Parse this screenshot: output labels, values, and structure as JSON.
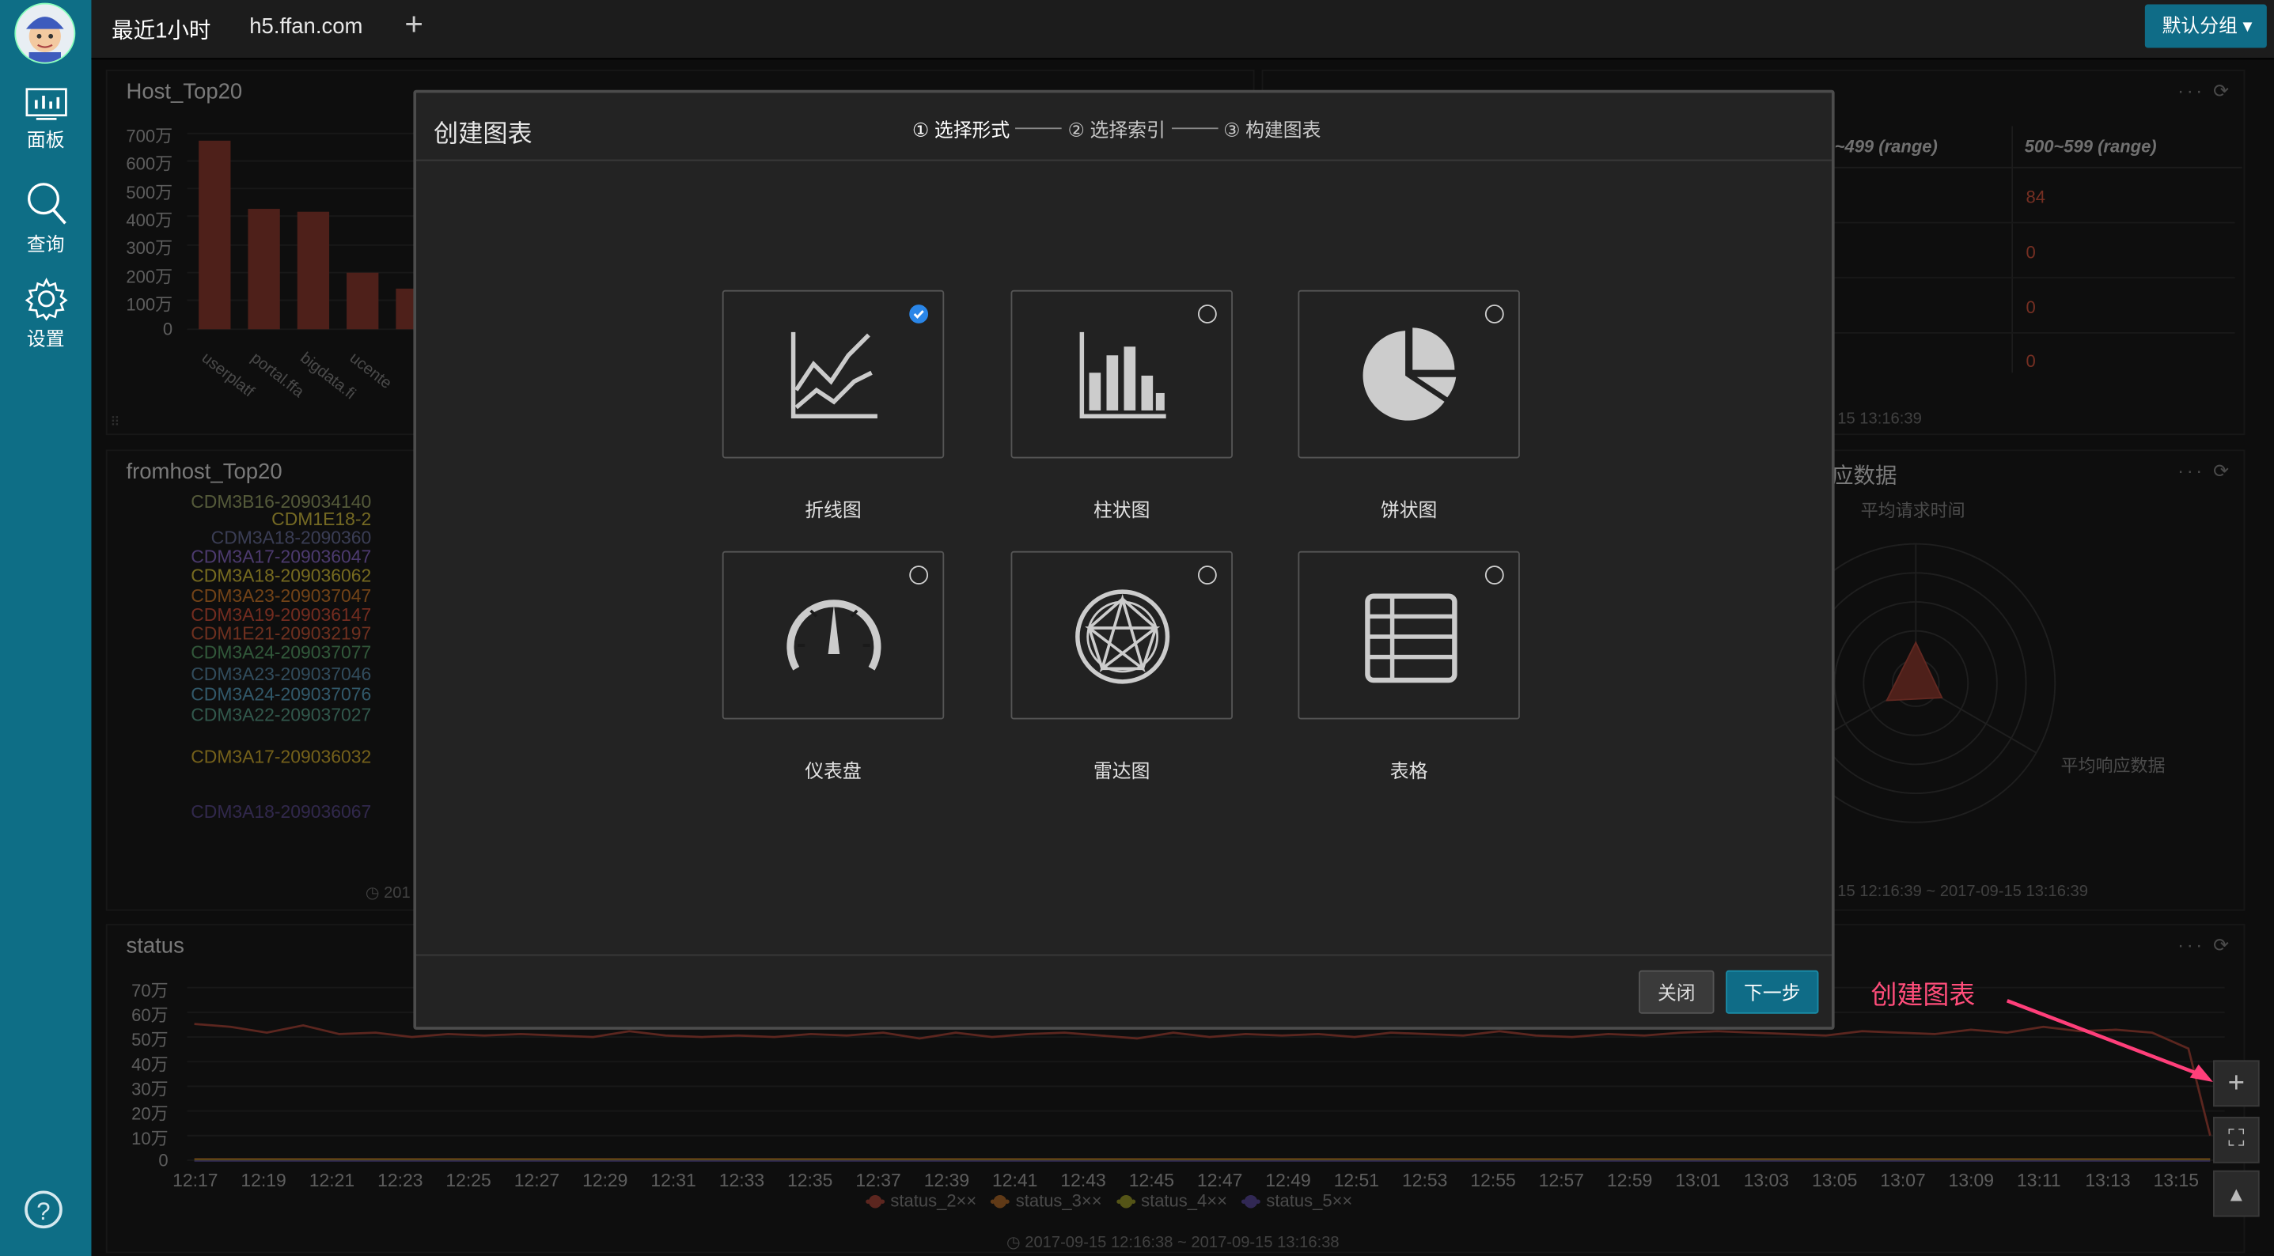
{
  "topbar": {
    "time_range": "最近1小时",
    "host": "h5.ffan.com",
    "add_label": "+",
    "group_button": "默认分组 ▾"
  },
  "sidebar": {
    "items": [
      {
        "label": "面板",
        "icon": "dashboard-icon"
      },
      {
        "label": "查询",
        "icon": "search-icon"
      },
      {
        "label": "设置",
        "icon": "gear-icon"
      }
    ],
    "help": "?"
  },
  "panels": {
    "host_top20": {
      "title": "Host_Top20",
      "yticks": [
        "700万",
        "600万",
        "500万",
        "400万",
        "300万",
        "200万",
        "100万",
        "0"
      ],
      "xticks": [
        "userplatf",
        "portal.ffa",
        "bigdata.fi",
        "ucente"
      ]
    },
    "health": {
      "col1": "~499 (range)",
      "col2": "500~599 (range)",
      "values": [
        "84",
        "0",
        "0",
        "0"
      ],
      "footer": "15 13:16:39"
    },
    "fromhost": {
      "title": "fromhost_Top20",
      "labels": [
        "CDM3B16-209034140",
        "CDM1E18-2",
        "CDM3A18-2090360",
        "CDM3A17-209036047",
        "CDM3A18-209036062",
        "CDM3A23-209037047",
        "CDM3A19-209036147",
        "CDM1E21-209032197",
        "CDM3A24-209037077",
        "CDM3A23-209037046",
        "CDM3A24-209037076",
        "CDM3A22-209037027",
        "CDM3A17-209036032",
        "CDM3A18-209036067"
      ],
      "footer": "201"
    },
    "radar": {
      "title": "应数据",
      "label_top": "平均请求时间",
      "label_right": "平均响应数据",
      "footer": "15 12:16:39 ~ 2017-09-15 13:16:39"
    },
    "status": {
      "title": "status",
      "yticks": [
        "70万",
        "60万",
        "50万",
        "40万",
        "30万",
        "20万",
        "10万",
        "0"
      ],
      "xticks": [
        "12:17",
        "12:19",
        "12:21",
        "12:23",
        "12:25",
        "12:27",
        "12:29",
        "12:31",
        "12:33",
        "12:35",
        "12:37",
        "12:39",
        "12:41",
        "12:43",
        "12:45",
        "12:47",
        "12:49",
        "12:51",
        "12:53",
        "12:55",
        "12:57",
        "12:59",
        "13:01",
        "13:03",
        "13:05",
        "13:07",
        "13:09",
        "13:11",
        "13:13",
        "13:15"
      ],
      "legend": [
        "status_2××",
        "status_3××",
        "status_4××",
        "status_5××"
      ],
      "footer": "2017-09-15 12:16:38 ~ 2017-09-15 13:16:38"
    }
  },
  "modal": {
    "title": "创建图表",
    "steps": [
      "① 选择形式",
      "② 选择索引",
      "③ 构建图表"
    ],
    "cards": [
      {
        "label": "折线图",
        "icon": "line-chart-icon",
        "checked": true
      },
      {
        "label": "柱状图",
        "icon": "bar-chart-icon",
        "checked": false
      },
      {
        "label": "饼状图",
        "icon": "pie-chart-icon",
        "checked": false
      },
      {
        "label": "仪表盘",
        "icon": "gauge-icon",
        "checked": false
      },
      {
        "label": "雷达图",
        "icon": "radar-chart-icon",
        "checked": false
      },
      {
        "label": "表格",
        "icon": "table-icon",
        "checked": false
      }
    ],
    "close_label": "关闭",
    "next_label": "下一步"
  },
  "annotation": "创建图表",
  "tools": [
    "+",
    "⛶",
    "▲"
  ]
}
